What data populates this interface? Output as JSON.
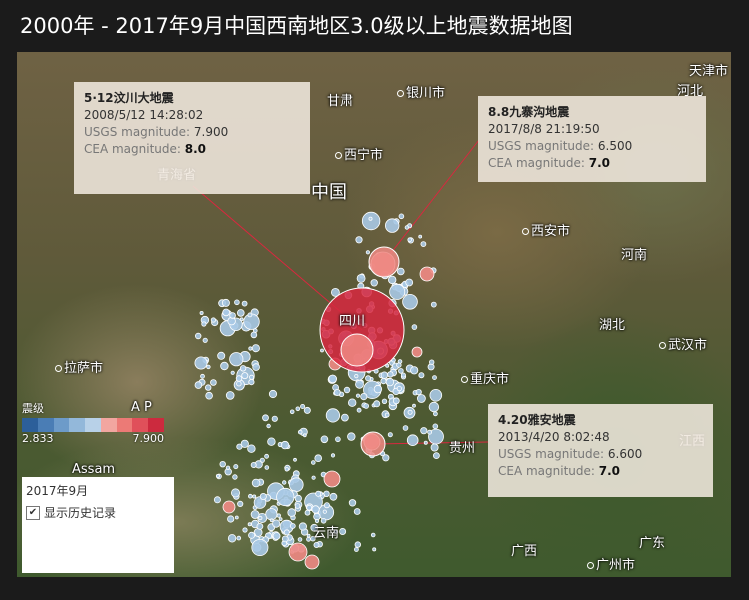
{
  "title": "2000年 - 2017年9月中国西南地区3.0级以上地震数据地图",
  "places": [
    {
      "text": "天津市",
      "cls": "place",
      "dot": false
    },
    {
      "text": "河北",
      "cls": "place",
      "dot": false
    },
    {
      "text": "银川市",
      "cls": "place",
      "dot": true
    },
    {
      "text": "河南",
      "cls": "place",
      "dot": false
    },
    {
      "text": "甘肃",
      "cls": "place",
      "dot": false
    },
    {
      "text": "西宁市",
      "cls": "place",
      "dot": true
    },
    {
      "text": "中国",
      "cls": "place big",
      "dot": false
    },
    {
      "text": "青海省",
      "cls": "place",
      "dot": false
    },
    {
      "text": "西安市",
      "cls": "place",
      "dot": true
    },
    {
      "text": "湖北",
      "cls": "place",
      "dot": false
    },
    {
      "text": "武汉市",
      "cls": "place",
      "dot": true
    },
    {
      "text": "拉萨市",
      "cls": "place",
      "dot": true
    },
    {
      "text": "重庆市",
      "cls": "place",
      "dot": true
    },
    {
      "text": "贵州",
      "cls": "place",
      "dot": false
    },
    {
      "text": "江西",
      "cls": "place",
      "dot": false
    },
    {
      "text": "Assam",
      "cls": "place",
      "dot": false
    },
    {
      "text": "云南",
      "cls": "place",
      "dot": false
    },
    {
      "text": "广西",
      "cls": "place",
      "dot": false
    },
    {
      "text": "广东",
      "cls": "place",
      "dot": false
    },
    {
      "text": "广州市",
      "cls": "place",
      "dot": true
    },
    {
      "text": "四川",
      "cls": "place",
      "dot": false
    },
    {
      "text": "A P",
      "cls": "place",
      "dot": false
    }
  ],
  "callouts": [
    {
      "name": "5·12汶川大地震",
      "time": "2008/5/12 14:28:02",
      "usgs_label": "USGS magnitude:",
      "usgs": "7.900",
      "cea_label": "CEA magnitude:",
      "cea": "8.0"
    },
    {
      "name": "8.8九寨沟地震",
      "time": "2017/8/8 21:19:50",
      "usgs_label": "USGS magnitude:",
      "usgs": "6.500",
      "cea_label": "CEA magnitude:",
      "cea": "7.0"
    },
    {
      "name": "4.20雅安地震",
      "time": "2013/4/20 8:02:48",
      "usgs_label": "USGS magnitude:",
      "usgs": "6.600",
      "cea_label": "CEA magnitude:",
      "cea": "7.0"
    }
  ],
  "legend": {
    "title": "震级",
    "min": "2.833",
    "max": "7.900",
    "colors": [
      "#2c5f9a",
      "#4a7db5",
      "#6d9bc9",
      "#93b8da",
      "#b8d1e8",
      "#f2a6a0",
      "#ec7a76",
      "#e0505a",
      "#cc2a3e"
    ]
  },
  "filter": {
    "year": "2017年9月",
    "history_label": "显示历史记录",
    "history_checked": true
  },
  "colors": {
    "quake_blue": "#a9c9e6",
    "quake_red": "#d8283f",
    "quake_pink": "#f08a84"
  }
}
